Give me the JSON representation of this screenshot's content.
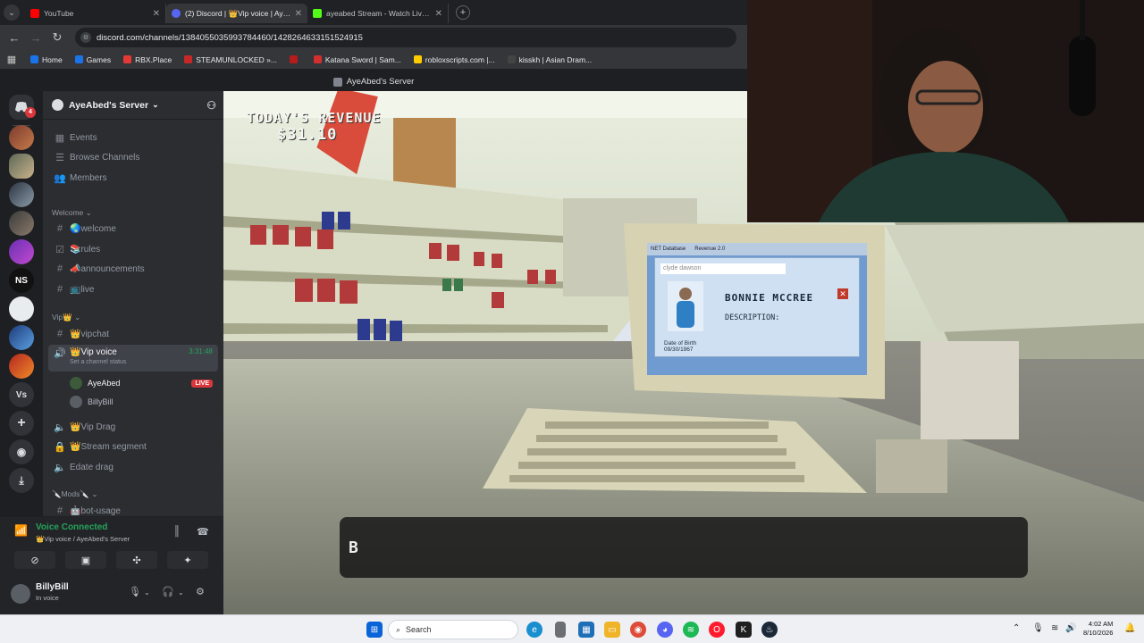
{
  "browser": {
    "tabs": [
      {
        "label": "YouTube",
        "color": "#ff0000"
      },
      {
        "label": "(2) Discord | 👑Vip voice | AyeAbed's Server",
        "color": "#5865f2"
      },
      {
        "label": "ayeabed Stream - Watch Live on Kick",
        "color": "#53fc18"
      }
    ],
    "url": "discord.com/channels/1384055035993784460/1428264633151524915",
    "bookmarks": [
      {
        "label": "Home",
        "color": "#1a73e8"
      },
      {
        "label": "Games",
        "color": "#1a73e8"
      },
      {
        "label": "RBX.Place",
        "color": "#e53935"
      },
      {
        "label": "STEAMUNLOCKED »...",
        "color": "#c62828"
      },
      {
        "label": "",
        "color": "#b71c1c"
      },
      {
        "label": "Katana Sword | Sam...",
        "color": "#d32f2f"
      },
      {
        "label": "robloxscripts.com |...",
        "color": "#ffcc00"
      },
      {
        "label": "kisskh | Asian Dram...",
        "color": "#444"
      }
    ]
  },
  "discord": {
    "window_title": "AyeAbed's Server",
    "server_name": "AyeAbed's Server",
    "top_items": [
      {
        "label": "Events",
        "icon": "calendar-icon"
      },
      {
        "label": "Browse Channels",
        "icon": "browse-icon"
      },
      {
        "label": "Members",
        "icon": "members-icon"
      }
    ],
    "categories": {
      "welcome": "Welcome",
      "vip": "Vip👑",
      "mods": "🔪Mods🔪"
    },
    "channels": {
      "welcome": "🌏welcome",
      "rules": "📚rules",
      "announcements": "📣announcements",
      "live": "📺live",
      "vipchat": "👑vipchat",
      "vip_voice": "👑Vip voice",
      "vip_voice_timer": "3:31:48",
      "vip_voice_status": "Set a channel status",
      "vip_drag": "👑Vip Drag",
      "stream_segment": "👑Stream segment",
      "edate_drag": "Edate drag",
      "bot_usage": "🤖bot-usage"
    },
    "voice_users": [
      {
        "name": "AyeAbed",
        "badge": "LIVE"
      },
      {
        "name": "BillyBill",
        "badge": ""
      }
    ],
    "voice_panel": {
      "title": "Voice Connected",
      "subtitle": "👑Vip voice / AyeAbed's Server"
    },
    "user": {
      "name": "BillyBill",
      "status": "In voice"
    },
    "rail_badge": "4",
    "rail_ns": "NS",
    "rail_vs": "Vs"
  },
  "game": {
    "revenue_label": "TODAY'S REVENUE",
    "revenue_amount": "$31.10",
    "screen_tabs": [
      "NET Database",
      "Revenue 2.0"
    ],
    "search_placeholder": "clyde dawson",
    "person_name": "BONNIE MCCREE",
    "description_label": "DESCRIPTION:",
    "dob_label": "Date of Birth",
    "dob_value": "09/30/1967",
    "subtitle_text": "B"
  },
  "taskbar": {
    "search_placeholder": "Search",
    "time": "4:02 AM",
    "date": "8/10/2026"
  }
}
